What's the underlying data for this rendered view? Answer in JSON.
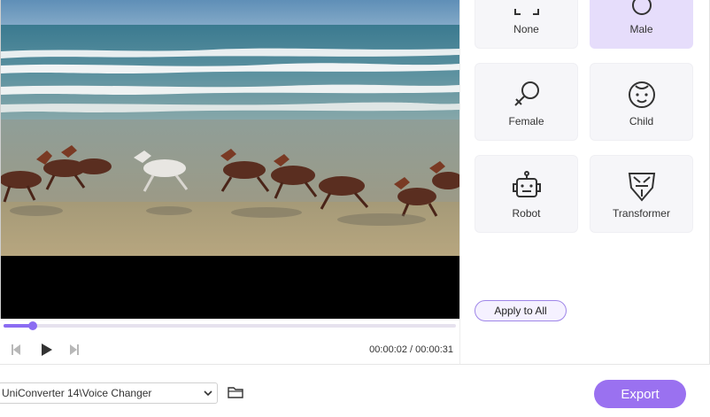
{
  "player": {
    "current_time": "00:00:02",
    "separator": " / ",
    "total_time": "00:00:31",
    "progress": 0.065
  },
  "voices": [
    {
      "label": "None",
      "icon": "none-frame-icon",
      "selected": false
    },
    {
      "label": "Male",
      "icon": "male-icon",
      "selected": true
    },
    {
      "label": "Female",
      "icon": "female-icon",
      "selected": false
    },
    {
      "label": "Child",
      "icon": "child-face-icon",
      "selected": false
    },
    {
      "label": "Robot",
      "icon": "robot-icon",
      "selected": false
    },
    {
      "label": "Transformer",
      "icon": "transformer-icon",
      "selected": false
    }
  ],
  "apply_all_label": "Apply to All",
  "output": {
    "path": "UniConverter 14\\Voice Changer"
  },
  "export_label": "Export",
  "colors": {
    "accent": "#9a71f0",
    "selected_card": "#e6ddfb",
    "card": "#f6f6f9"
  }
}
